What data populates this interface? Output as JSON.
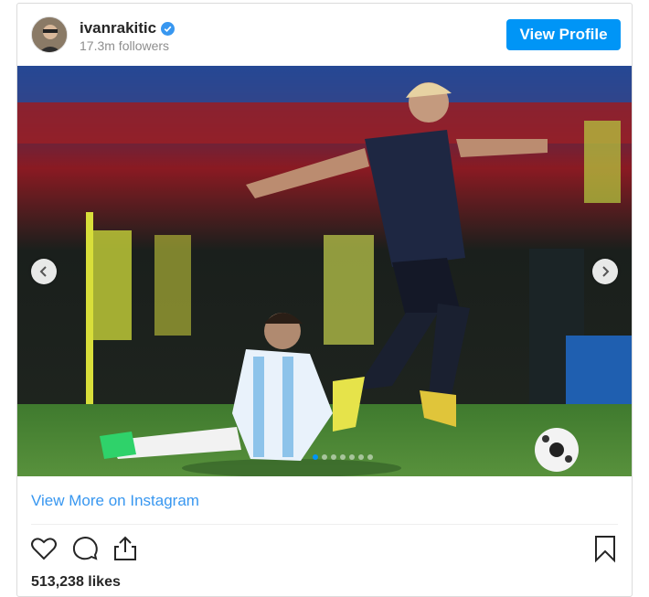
{
  "header": {
    "username": "ivanrakitic",
    "followers": "17.3m followers",
    "view_profile_label": "View Profile"
  },
  "media": {
    "carousel_dots": 7,
    "active_dot": 0
  },
  "footer": {
    "more_link": "View More on Instagram",
    "likes": "513,238 likes"
  },
  "colors": {
    "accent": "#0095f6",
    "link": "#3897f0"
  },
  "icons": [
    "verified-badge-icon",
    "chevron-left-icon",
    "chevron-right-icon",
    "heart-icon",
    "comment-icon",
    "share-icon",
    "bookmark-icon"
  ]
}
